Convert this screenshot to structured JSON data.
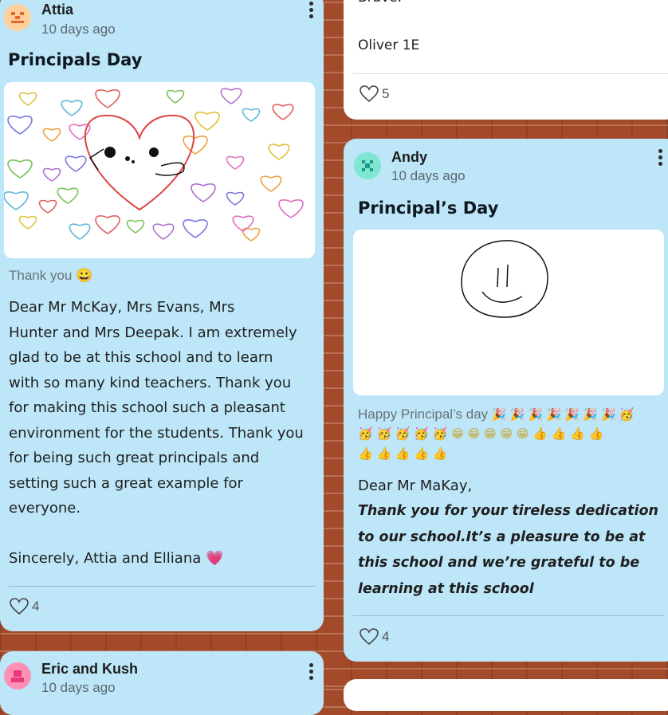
{
  "cards": {
    "attia": {
      "author": "Attia",
      "time": "10 days ago",
      "title": "Principals Day",
      "caption": "Thank you 😀",
      "body": "Dear Mr McKay, Mrs Evans, Mrs\nHunter and Mrs Deepak. I am extremely\nglad to be at this school and to learn\nwith so many kind teachers. Thank you\nfor making this school such a pleasant\nenvironment for the students. Thank you\nfor being such great principals and\nsetting such a great example for\neveryone.\n\nSincerely, Attia and Elliana 💗",
      "likes": "4"
    },
    "oliver": {
      "partial_text": "Brave.",
      "signature": "Oliver 1E",
      "likes": "5"
    },
    "andy": {
      "author": "Andy",
      "time": "10 days ago",
      "title": "Principal’s Day",
      "caption": "Happy Principal’s day",
      "emojis_line1": "🎉 🎉 🎉 🎉 🎉 🎉 🎉 🥳",
      "emojis_line2": "🥳 🥳 🥳 🥳 🥳 😁 😁 😁 😁 😁 👍 👍 👍 👍",
      "emojis_line3": "👍 👍 👍 👍 👍",
      "greeting": "Dear Mr MaKay,",
      "body": "Thank you for your tireless dedication\nto our school.It’s a pleasure to be at\nthis school and we’re grateful to be\nlearning at this school",
      "likes": "4"
    },
    "eric": {
      "author": "Eric and Kush",
      "time": "10 days ago"
    }
  },
  "colors": {
    "card_blue": "#bde6f8",
    "brick": "#a24a2a",
    "avatar_attia": "#ffcf9e",
    "avatar_andy": "#7ee6d2",
    "avatar_eric": "#ff8fb5"
  }
}
